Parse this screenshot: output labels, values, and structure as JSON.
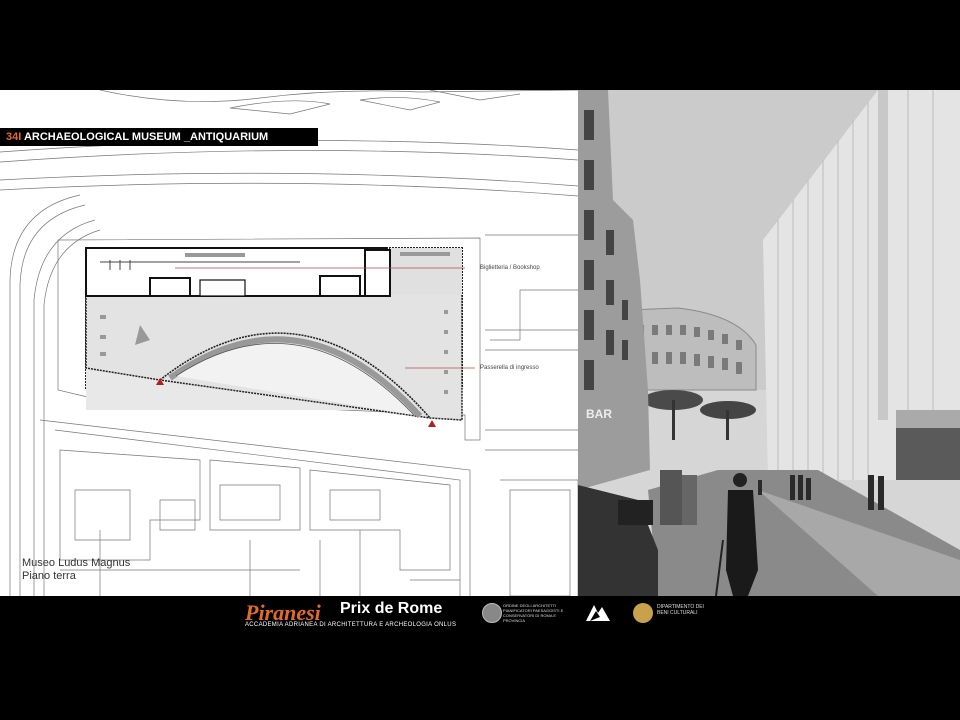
{
  "header": {
    "number": "34",
    "separator": "I",
    "title": "ARCHAEOLOGICAL MUSEUM _ANTIQUARIUM"
  },
  "plan": {
    "label_ticket": "Biglietteria / Bookshop",
    "label_walkway": "Passerella di ingresso",
    "caption_line1": "Museo Ludus Magnus",
    "caption_line2": "Piano terra"
  },
  "photo": {
    "sign_text": "BAR"
  },
  "footer": {
    "logo_text": "Piranesi",
    "title": "Prix de Rome",
    "subtitle": "ACCADEMIA ADRIANEA DI ARCHITETTURA E ARCHEOLOGIA ONLUS",
    "partner1": "ORDINE DEGLI ARCHITETTI PIANIFICATORI PAESAGGISTI E CONSERVATORI DI ROMA E PROVINCIA",
    "partner3": "DIPARTIMENTO DEI BENI CULTURALI"
  },
  "colors": {
    "accent": "#e56a2a",
    "background": "#000000"
  }
}
